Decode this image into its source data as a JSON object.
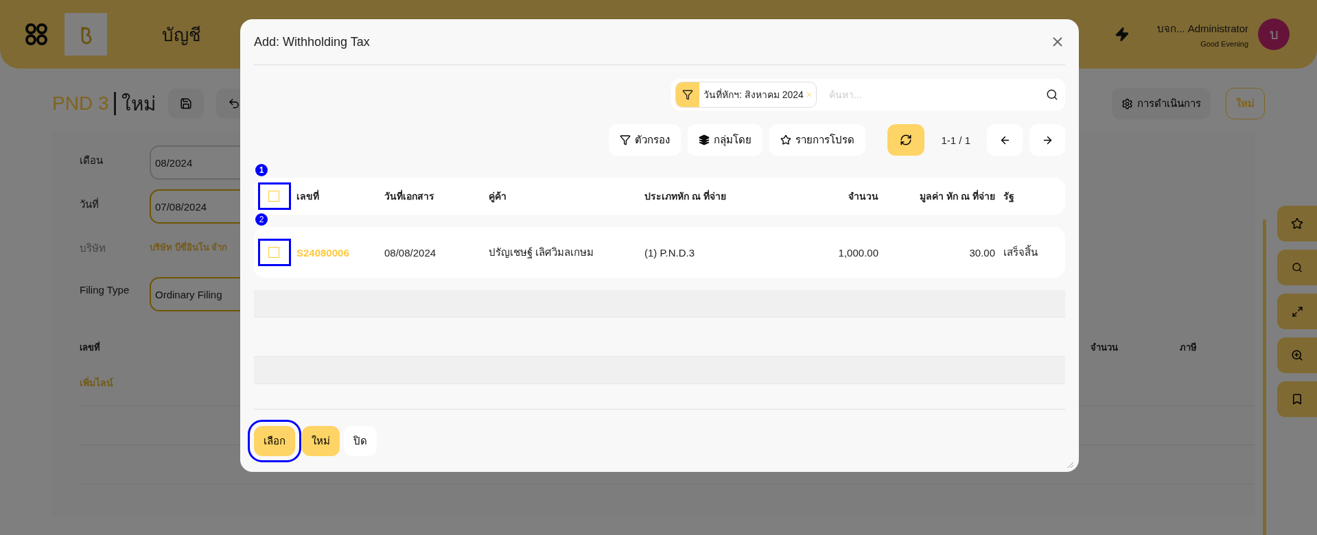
{
  "topbar": {
    "module": "บัญชี",
    "user": "บจก... Administrator",
    "greeting": "Good Evening",
    "avatar": "บ"
  },
  "page": {
    "doc_type": "PND 3",
    "status": "ใหม่",
    "actions_button": "การดำเนินการ",
    "new_button": "ใหม่"
  },
  "form": [
    {
      "label": "เดือน",
      "value": "08/2024",
      "kind": "input",
      "highlighted": false
    },
    {
      "label": "วันที่",
      "value": "07/08/2024",
      "kind": "input",
      "highlighted": true
    },
    {
      "label": "บริษัท",
      "value": "บริษัท บีซี่อินโน จำก",
      "kind": "link"
    },
    {
      "label": "Filing Type",
      "value": "Ordinary Filing",
      "kind": "input",
      "highlighted": true
    }
  ],
  "lines_table": {
    "columns": [
      "เลขที่",
      "จำนวน",
      "ภาษี"
    ],
    "add_line": "เพิ่มไลน์"
  },
  "dialog": {
    "title": "Add: Withholding Tax",
    "filter_chip": "วันที่หักฯ: สิงหาคม 2024",
    "search": {
      "placeholder": "ค้นหา..."
    },
    "toolbar": [
      "ตัวกรอง",
      "กลุ่มโดย",
      "รายการโปรด"
    ],
    "pager": "1-1 / 1",
    "header_checkbox": {
      "checked": false,
      "marker": "1",
      "outlined": true
    },
    "columns": [
      "เลขที่",
      "วันที่เอกสาร",
      "คู่ค้า",
      "ประเภทหัก ณ ที่จ่าย",
      "จำนวน",
      "มูลค่า หัก ณ ที่จ่าย",
      "รัฐ"
    ],
    "rows": [
      {
        "checked": false,
        "marker": "2",
        "outlined": true,
        "cells": [
          "S24080006",
          "08/08/2024",
          "ปรัญเชษฐ์ เลิศวิมลเกษม",
          "(1) P.N.D.3",
          "1,000.00",
          "30.00",
          "เสร็จสิ้น"
        ]
      }
    ],
    "footer_buttons": [
      {
        "label": "เลือก",
        "kind": "primary",
        "outlined": true
      },
      {
        "label": "ใหม่",
        "kind": "primary",
        "outlined": false
      },
      {
        "label": "ปิด",
        "kind": "plain",
        "outlined": false
      }
    ]
  }
}
